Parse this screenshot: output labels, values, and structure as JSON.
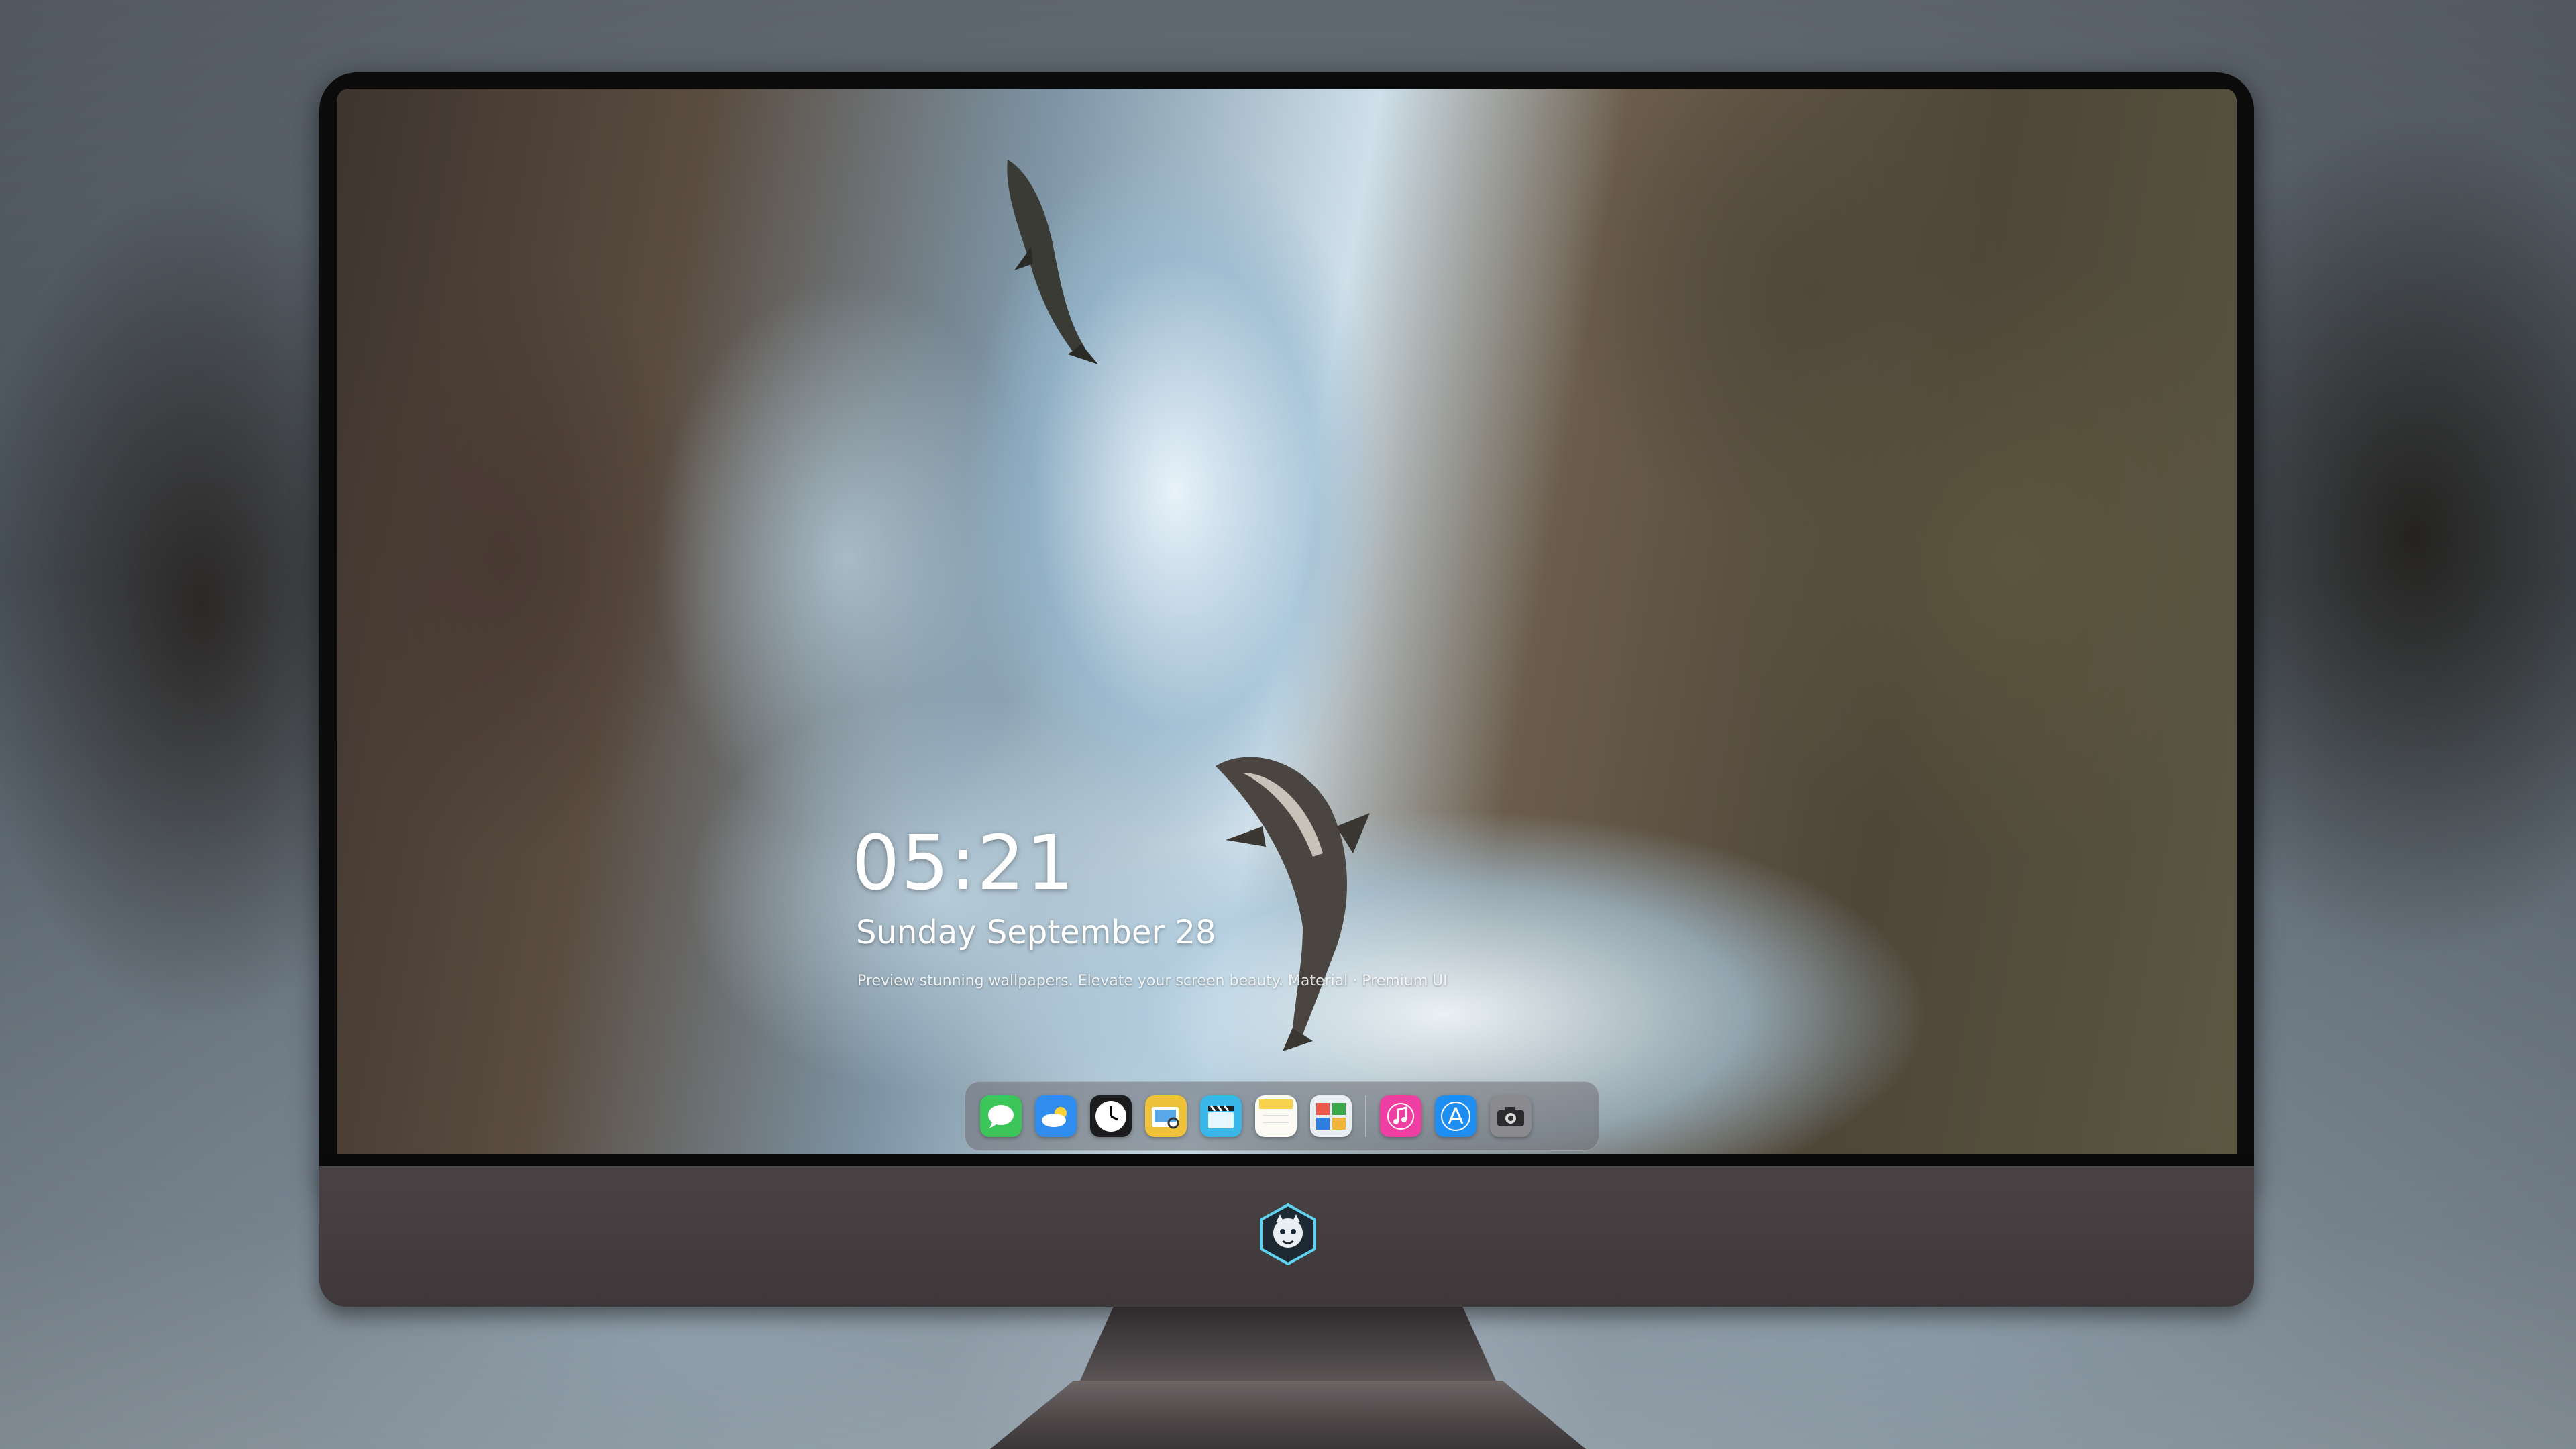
{
  "lock_screen": {
    "time": "05:21",
    "date": "Sunday September  28",
    "caption": "Preview stunning wallpapers. Elevate your screen beauty. Material · Premium UI"
  },
  "dock": {
    "apps": [
      {
        "name": "Messages",
        "icon": "messages-icon",
        "color": "#3cc65a"
      },
      {
        "name": "Weather",
        "icon": "weather-icon",
        "color": "#2f8df0"
      },
      {
        "name": "Clock",
        "icon": "clock-icon",
        "color": "#1c1c1e"
      },
      {
        "name": "Preview",
        "icon": "preview-icon",
        "color": "#f0c23a"
      },
      {
        "name": "Clips",
        "icon": "clapper-icon",
        "color": "#39b7e8"
      },
      {
        "name": "Notes",
        "icon": "notes-icon",
        "color": "#f7d24a"
      },
      {
        "name": "Photos",
        "icon": "photo-gallery-icon",
        "color": "#e9eef2"
      },
      {
        "name": "Music",
        "icon": "music-icon",
        "color": "#f03fa3"
      },
      {
        "name": "App Store",
        "icon": "app-store-icon",
        "color": "#1e8ef2"
      },
      {
        "name": "Camera",
        "icon": "camera-icon",
        "color": "#8b8b8f"
      }
    ]
  },
  "colors": {
    "chin": "#4a4345",
    "bezel": "#0b0b0c",
    "dock_background": "rgba(110,110,115,0.55)"
  }
}
